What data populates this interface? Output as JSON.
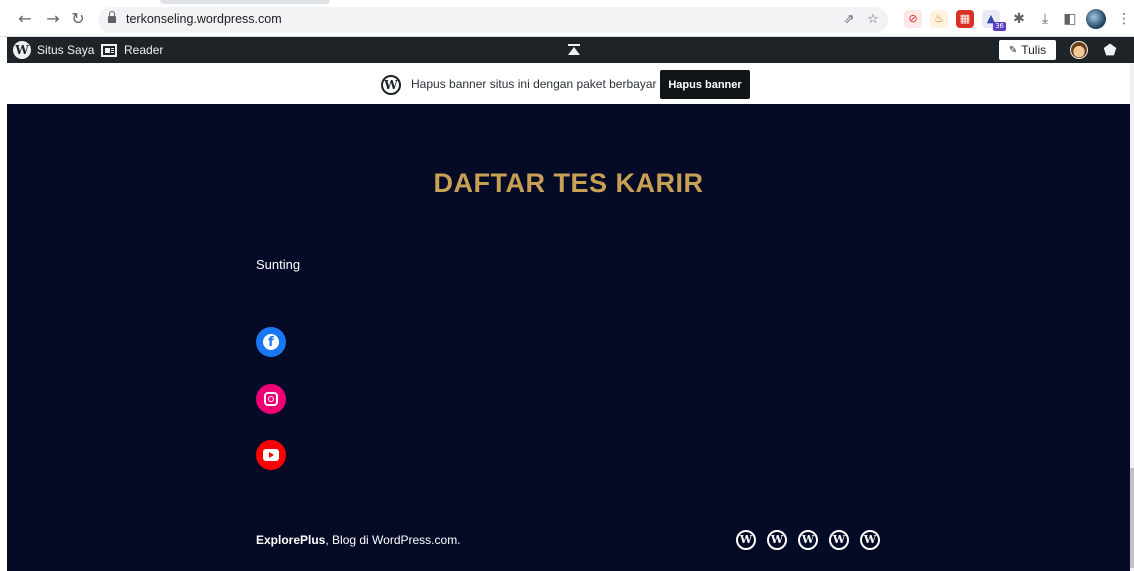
{
  "browser": {
    "url": "terkonseling.wordpress.com",
    "extension_badge": "36",
    "icons": [
      "back-icon",
      "forward-icon",
      "reload-icon",
      "lock-icon",
      "share-icon",
      "bookmark-star-icon",
      "download-icon",
      "side-panel-icon",
      "profile-icon",
      "menu-icon"
    ]
  },
  "adminbar": {
    "my_site_label": "Situs Saya",
    "reader_label": "Reader",
    "write_label": "Tulis"
  },
  "banner": {
    "text": "Hapus banner situs ini dengan paket berbayar",
    "button_label": "Hapus banner"
  },
  "page": {
    "title": "DAFTAR TES KARIR",
    "edit_label": "Sunting",
    "social": [
      "facebook",
      "instagram",
      "youtube"
    ]
  },
  "footer": {
    "site_name": "ExplorePlus",
    "credit_suffix": ", Blog di WordPress.com."
  },
  "colors": {
    "site_background": "#050b26",
    "title_gold": "#c8a054",
    "adminbar": "#1d2327"
  }
}
